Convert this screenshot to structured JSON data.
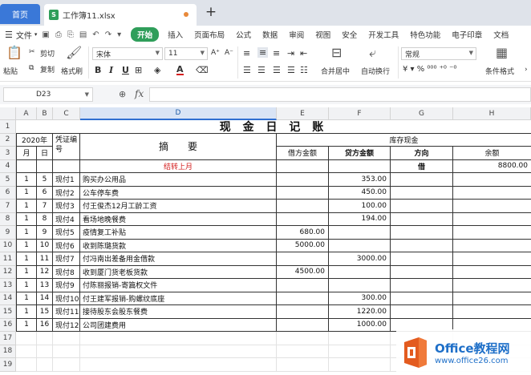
{
  "tabs": {
    "home": "首页",
    "file_icon": "S",
    "file": "工作簿11.xlsx",
    "new_tab": "+"
  },
  "menu": {
    "file": "文件",
    "items": [
      "开始",
      "插入",
      "页面布局",
      "公式",
      "数据",
      "审阅",
      "视图",
      "安全",
      "开发工具",
      "特色功能",
      "电子印章",
      "文档"
    ],
    "active_index": 0
  },
  "ribbon": {
    "cut": "剪切",
    "paste": "粘贴",
    "copy": "复制",
    "format_painter": "格式刷",
    "font_name": "宋体",
    "font_size": "11",
    "bold": "B",
    "italic": "I",
    "underline": "U",
    "font_color_a": "A",
    "merge_center": "合并居中",
    "wrap_text": "自动换行",
    "number_format": "常规",
    "cond_format": "条件格式",
    "inc_font": "A⁺",
    "dec_font": "A⁻"
  },
  "formula_bar": {
    "cell_ref": "D23",
    "fx": "fx",
    "value": ""
  },
  "columns": [
    "A",
    "B",
    "C",
    "D",
    "E",
    "F",
    "G",
    "H"
  ],
  "selected_column": "D",
  "rows": [
    "1",
    "2",
    "3",
    "4",
    "5",
    "6",
    "7",
    "8",
    "9",
    "10",
    "11",
    "12",
    "13",
    "14",
    "15",
    "16",
    "17",
    "18",
    "19"
  ],
  "sheet": {
    "title": "现 金 日 记 账",
    "year": "2020年",
    "month": "月",
    "day": "日",
    "voucher": "凭证编号",
    "summary": "摘　　要",
    "cash": "库存现金",
    "debit": "借方金额",
    "credit": "贷方金额",
    "direction": "方向",
    "balance": "余额",
    "carry_forward": "结转上月",
    "carry_direction": "借",
    "carry_balance": "8800.00",
    "entries": [
      {
        "m": "1",
        "d": "5",
        "v": "现付1",
        "s": "购买办公用品",
        "dr": "",
        "cr": "353.00"
      },
      {
        "m": "1",
        "d": "6",
        "v": "现付2",
        "s": "公车停车费",
        "dr": "",
        "cr": "450.00"
      },
      {
        "m": "1",
        "d": "7",
        "v": "现付3",
        "s": "付王俊杰12月工龄工资",
        "dr": "",
        "cr": "100.00"
      },
      {
        "m": "1",
        "d": "8",
        "v": "现付4",
        "s": "看场地晚餐费",
        "dr": "",
        "cr": "194.00"
      },
      {
        "m": "1",
        "d": "9",
        "v": "现付5",
        "s": "疫情复工补贴",
        "dr": "680.00",
        "cr": ""
      },
      {
        "m": "1",
        "d": "10",
        "v": "现付6",
        "s": "收到陈璐货款",
        "dr": "5000.00",
        "cr": ""
      },
      {
        "m": "1",
        "d": "11",
        "v": "现付7",
        "s": "付冯南出差备用金借款",
        "dr": "",
        "cr": "3000.00"
      },
      {
        "m": "1",
        "d": "12",
        "v": "现付8",
        "s": "收到厦门货老板货款",
        "dr": "4500.00",
        "cr": ""
      },
      {
        "m": "1",
        "d": "13",
        "v": "现付9",
        "s": "付陈丽报销-寄篇权文件",
        "dr": "",
        "cr": ""
      },
      {
        "m": "1",
        "d": "14",
        "v": "现付10",
        "s": "付王建军报销-购螺纹底座",
        "dr": "",
        "cr": "300.00"
      },
      {
        "m": "1",
        "d": "15",
        "v": "现付11",
        "s": "接待股东会股东餐费",
        "dr": "",
        "cr": "1220.00"
      },
      {
        "m": "1",
        "d": "16",
        "v": "现付12",
        "s": "公司团建费用",
        "dr": "",
        "cr": "1000.00"
      }
    ]
  },
  "watermark": {
    "title": "Office教程网",
    "url": "www.office26.com"
  },
  "colors": {
    "accent_green": "#2f9e5a",
    "home_blue": "#3a78d8",
    "carry_red": "#d42020"
  }
}
